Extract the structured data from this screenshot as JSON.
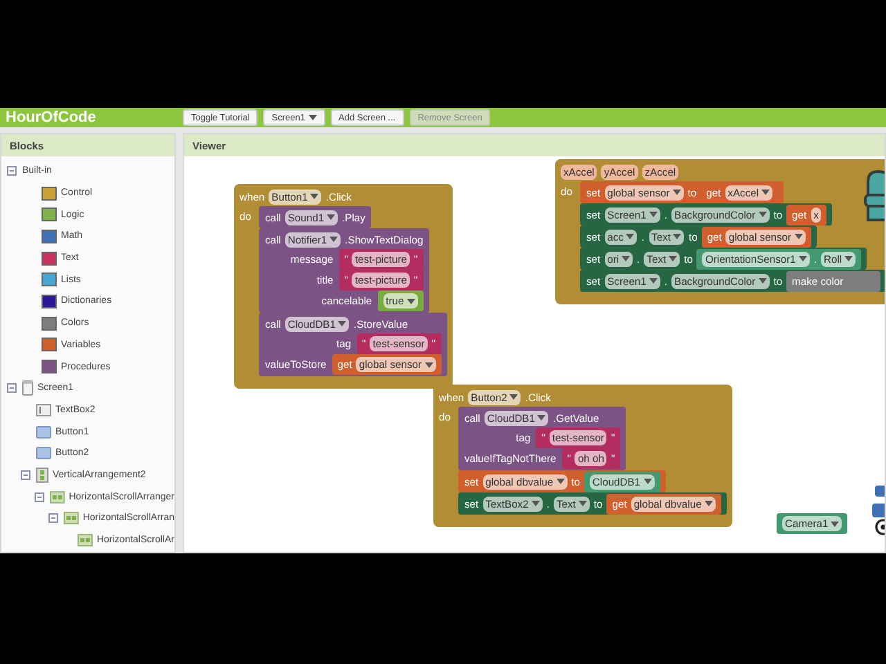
{
  "app_bar": {
    "title": "HourOfCode",
    "buttons": [
      {
        "kind": "button",
        "label": "Toggle Tutorial",
        "disabled": false
      },
      {
        "kind": "dropdown",
        "label": "Screen1",
        "disabled": false
      },
      {
        "kind": "button",
        "label": "Add Screen ...",
        "disabled": false
      },
      {
        "kind": "button",
        "label": "Remove Screen",
        "disabled": true
      }
    ]
  },
  "blocks_panel": {
    "title": "Blocks",
    "tree": [
      {
        "label": "Built-in",
        "expanded": true,
        "children": [
          {
            "label": "Control",
            "kind": "swatch",
            "color": "#c9a236"
          },
          {
            "label": "Logic",
            "kind": "swatch",
            "color": "#7fb14c"
          },
          {
            "label": "Math",
            "kind": "swatch",
            "color": "#3f71b5"
          },
          {
            "label": "Text",
            "kind": "swatch",
            "color": "#c7325f"
          },
          {
            "label": "Lists",
            "kind": "swatch",
            "color": "#49a6d4"
          },
          {
            "label": "Dictionaries",
            "kind": "swatch",
            "color": "#2d1799"
          },
          {
            "label": "Colors",
            "kind": "swatch",
            "color": "#7d7d7d"
          },
          {
            "label": "Variables",
            "kind": "swatch",
            "color": "#d05f2d"
          },
          {
            "label": "Procedures",
            "kind": "swatch",
            "color": "#7c5385"
          }
        ]
      },
      {
        "label": "Screen1",
        "kind": "screen",
        "expanded": true,
        "children": [
          {
            "label": "TextBox2",
            "kind": "textbox"
          },
          {
            "label": "Button1",
            "kind": "button"
          },
          {
            "label": "Button2",
            "kind": "button"
          },
          {
            "label": "VerticalArrangement2",
            "kind": "vertical",
            "expanded": true,
            "children": [
              {
                "label": "HorizontalScrollArranger",
                "kind": "horizontal",
                "expanded": true,
                "children": [
                  {
                    "label": "HorizontalScrollArran",
                    "kind": "horizontal",
                    "expanded": true,
                    "children": [
                      {
                        "label": "HorizontalScrollAr",
                        "kind": "horizontal"
                      }
                    ]
                  }
                ]
              }
            ]
          }
        ]
      }
    ]
  },
  "viewer": {
    "title": "Viewer",
    "blocks": [
      {
        "kind": "event",
        "header": [
          {
            "kind": "word",
            "text": "when"
          },
          {
            "kind": "dd",
            "text": "Button1"
          },
          {
            "kind": "word",
            "text": ".Click"
          }
        ],
        "do": "do",
        "statements": [
          {
            "kind": "method",
            "parts": [
              {
                "kind": "word",
                "text": "call"
              },
              {
                "kind": "dd",
                "text": "Sound1"
              },
              {
                "kind": "word",
                "text": ".Play"
              }
            ]
          },
          {
            "kind": "method",
            "parts": [
              {
                "kind": "word",
                "text": "call"
              },
              {
                "kind": "dd",
                "text": "Notifier1"
              },
              {
                "kind": "word",
                "text": ".ShowTextDialog"
              }
            ],
            "args": [
              {
                "label": "message",
                "plug": {
                  "kind": "text",
                  "parts": [
                    {
                      "kind": "word",
                      "text": "\""
                    },
                    {
                      "kind": "field",
                      "text": "test-picture"
                    },
                    {
                      "kind": "word",
                      "text": "\""
                    }
                  ]
                }
              },
              {
                "label": "title",
                "plug": {
                  "kind": "text",
                  "parts": [
                    {
                      "kind": "word",
                      "text": "\""
                    },
                    {
                      "kind": "field",
                      "text": "test-picture"
                    },
                    {
                      "kind": "word",
                      "text": "\""
                    }
                  ]
                }
              },
              {
                "label": "cancelable",
                "plug": {
                  "kind": "logic",
                  "parts": [
                    {
                      "kind": "dd",
                      "text": "true"
                    }
                  ]
                }
              }
            ]
          },
          {
            "kind": "method",
            "parts": [
              {
                "kind": "word",
                "text": "call"
              },
              {
                "kind": "dd",
                "text": "CloudDB1"
              },
              {
                "kind": "word",
                "text": ".StoreValue"
              }
            ],
            "args": [
              {
                "label": "tag",
                "plug": {
                  "kind": "text",
                  "parts": [
                    {
                      "kind": "word",
                      "text": "\""
                    },
                    {
                      "kind": "field",
                      "text": "test-sensor"
                    },
                    {
                      "kind": "word",
                      "text": "\""
                    }
                  ]
                }
              },
              {
                "label": "valueToStore",
                "plug": {
                  "kind": "variable",
                  "parts": [
                    {
                      "kind": "word",
                      "text": "get"
                    },
                    {
                      "kind": "dd",
                      "text": "global sensor"
                    }
                  ]
                }
              }
            ]
          }
        ]
      },
      {
        "kind": "event",
        "header": [
          {
            "kind": "param",
            "text": "xAccel"
          },
          {
            "kind": "param",
            "text": "yAccel"
          },
          {
            "kind": "param",
            "text": "zAccel"
          }
        ],
        "do": "do",
        "statements": [
          {
            "kind": "variable",
            "parts": [
              {
                "kind": "word",
                "text": "set"
              },
              {
                "kind": "dd",
                "text": "global sensor"
              },
              {
                "kind": "word",
                "text": "to"
              },
              {
                "kind": "plug",
                "block": {
                  "kind": "variable",
                  "parts": [
                    {
                      "kind": "word",
                      "text": "get"
                    },
                    {
                      "kind": "dd",
                      "text": "xAccel"
                    }
                  ]
                }
              }
            ]
          },
          {
            "kind": "setter",
            "parts": [
              {
                "kind": "word",
                "text": "set"
              },
              {
                "kind": "dd",
                "text": "Screen1"
              },
              {
                "kind": "word",
                "text": "."
              },
              {
                "kind": "dd",
                "text": "BackgroundColor"
              },
              {
                "kind": "word",
                "text": "to"
              },
              {
                "kind": "plug",
                "block": {
                  "kind": "variable",
                  "parts": [
                    {
                      "kind": "word",
                      "text": "get"
                    },
                    {
                      "kind": "field",
                      "text": "x"
                    }
                  ]
                }
              }
            ]
          },
          {
            "kind": "setter",
            "parts": [
              {
                "kind": "word",
                "text": "set"
              },
              {
                "kind": "dd",
                "text": "acc"
              },
              {
                "kind": "word",
                "text": "."
              },
              {
                "kind": "dd",
                "text": "Text"
              },
              {
                "kind": "word",
                "text": "to"
              },
              {
                "kind": "plug",
                "block": {
                  "kind": "variable",
                  "parts": [
                    {
                      "kind": "word",
                      "text": "get"
                    },
                    {
                      "kind": "dd",
                      "text": "global sensor"
                    }
                  ]
                }
              }
            ]
          },
          {
            "kind": "setter",
            "parts": [
              {
                "kind": "word",
                "text": "set"
              },
              {
                "kind": "dd",
                "text": "ori"
              },
              {
                "kind": "word",
                "text": "."
              },
              {
                "kind": "dd",
                "text": "Text"
              },
              {
                "kind": "word",
                "text": "to"
              },
              {
                "kind": "plug",
                "block": {
                  "kind": "component",
                  "parts": [
                    {
                      "kind": "dd",
                      "text": "OrientationSensor1"
                    },
                    {
                      "kind": "word",
                      "text": "."
                    },
                    {
                      "kind": "dd",
                      "text": "Roll"
                    }
                  ]
                }
              }
            ]
          },
          {
            "kind": "setter",
            "parts": [
              {
                "kind": "word",
                "text": "set"
              },
              {
                "kind": "dd",
                "text": "Screen1"
              },
              {
                "kind": "word",
                "text": "."
              },
              {
                "kind": "dd",
                "text": "BackgroundColor"
              },
              {
                "kind": "word",
                "text": "to"
              },
              {
                "kind": "plug",
                "block": {
                  "kind": "color",
                  "parts": [
                    {
                      "kind": "word",
                      "text": "make color"
                    }
                  ]
                }
              }
            ]
          }
        ]
      },
      {
        "kind": "event",
        "header": [
          {
            "kind": "word",
            "text": "when"
          },
          {
            "kind": "dd",
            "text": "Button2"
          },
          {
            "kind": "word",
            "text": ".Click"
          }
        ],
        "do": "do",
        "statements": [
          {
            "kind": "method",
            "parts": [
              {
                "kind": "word",
                "text": "call"
              },
              {
                "kind": "dd",
                "text": "CloudDB1"
              },
              {
                "kind": "word",
                "text": ".GetValue"
              }
            ],
            "args": [
              {
                "label": "tag",
                "plug": {
                  "kind": "text",
                  "parts": [
                    {
                      "kind": "word",
                      "text": "\""
                    },
                    {
                      "kind": "field",
                      "text": "test-sensor"
                    },
                    {
                      "kind": "word",
                      "text": "\""
                    }
                  ]
                }
              },
              {
                "label": "valueIfTagNotThere",
                "plug": {
                  "kind": "text",
                  "parts": [
                    {
                      "kind": "word",
                      "text": "\""
                    },
                    {
                      "kind": "field",
                      "text": "oh oh"
                    },
                    {
                      "kind": "word",
                      "text": "\""
                    }
                  ]
                }
              }
            ]
          },
          {
            "kind": "variable",
            "parts": [
              {
                "kind": "word",
                "text": "set"
              },
              {
                "kind": "dd",
                "text": "global dbvalue"
              },
              {
                "kind": "word",
                "text": "to"
              },
              {
                "kind": "plug",
                "block": {
                  "kind": "component",
                  "parts": [
                    {
                      "kind": "dd",
                      "text": "CloudDB1"
                    }
                  ]
                }
              }
            ]
          },
          {
            "kind": "setter",
            "parts": [
              {
                "kind": "word",
                "text": "set"
              },
              {
                "kind": "dd",
                "text": "TextBox2"
              },
              {
                "kind": "word",
                "text": "."
              },
              {
                "kind": "dd",
                "text": "Text"
              },
              {
                "kind": "word",
                "text": "to"
              },
              {
                "kind": "plug",
                "block": {
                  "kind": "variable",
                  "parts": [
                    {
                      "kind": "word",
                      "text": "get"
                    },
                    {
                      "kind": "dd",
                      "text": "global dbvalue"
                    }
                  ]
                }
              }
            ]
          }
        ]
      },
      {
        "kind": "value",
        "block": {
          "kind": "component",
          "parts": [
            {
              "kind": "dd",
              "text": "Camera1"
            }
          ]
        }
      }
    ]
  }
}
